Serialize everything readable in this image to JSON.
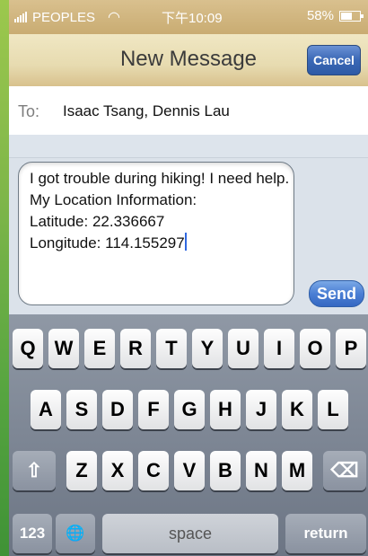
{
  "status": {
    "carrier": "PEOPLES",
    "time": "下午10:09",
    "battery": "58%"
  },
  "nav": {
    "title": "New Message",
    "cancel_label": "Cancel"
  },
  "compose": {
    "to_label": "To:",
    "recipients": "Isaac Tsang, Dennis Lau",
    "message": "I got trouble during hiking! I need help. My Location Information:\nLatitude: 22.336667\nLongitude: 114.155297",
    "send_label": "Send"
  },
  "keyboard": {
    "row1": [
      "Q",
      "W",
      "E",
      "R",
      "T",
      "Y",
      "U",
      "I",
      "O",
      "P"
    ],
    "row2": [
      "A",
      "S",
      "D",
      "F",
      "G",
      "H",
      "J",
      "K",
      "L"
    ],
    "row3": [
      "Z",
      "X",
      "C",
      "V",
      "B",
      "N",
      "M"
    ],
    "numbers_label": "123",
    "space_label": "space",
    "return_label": "return"
  }
}
